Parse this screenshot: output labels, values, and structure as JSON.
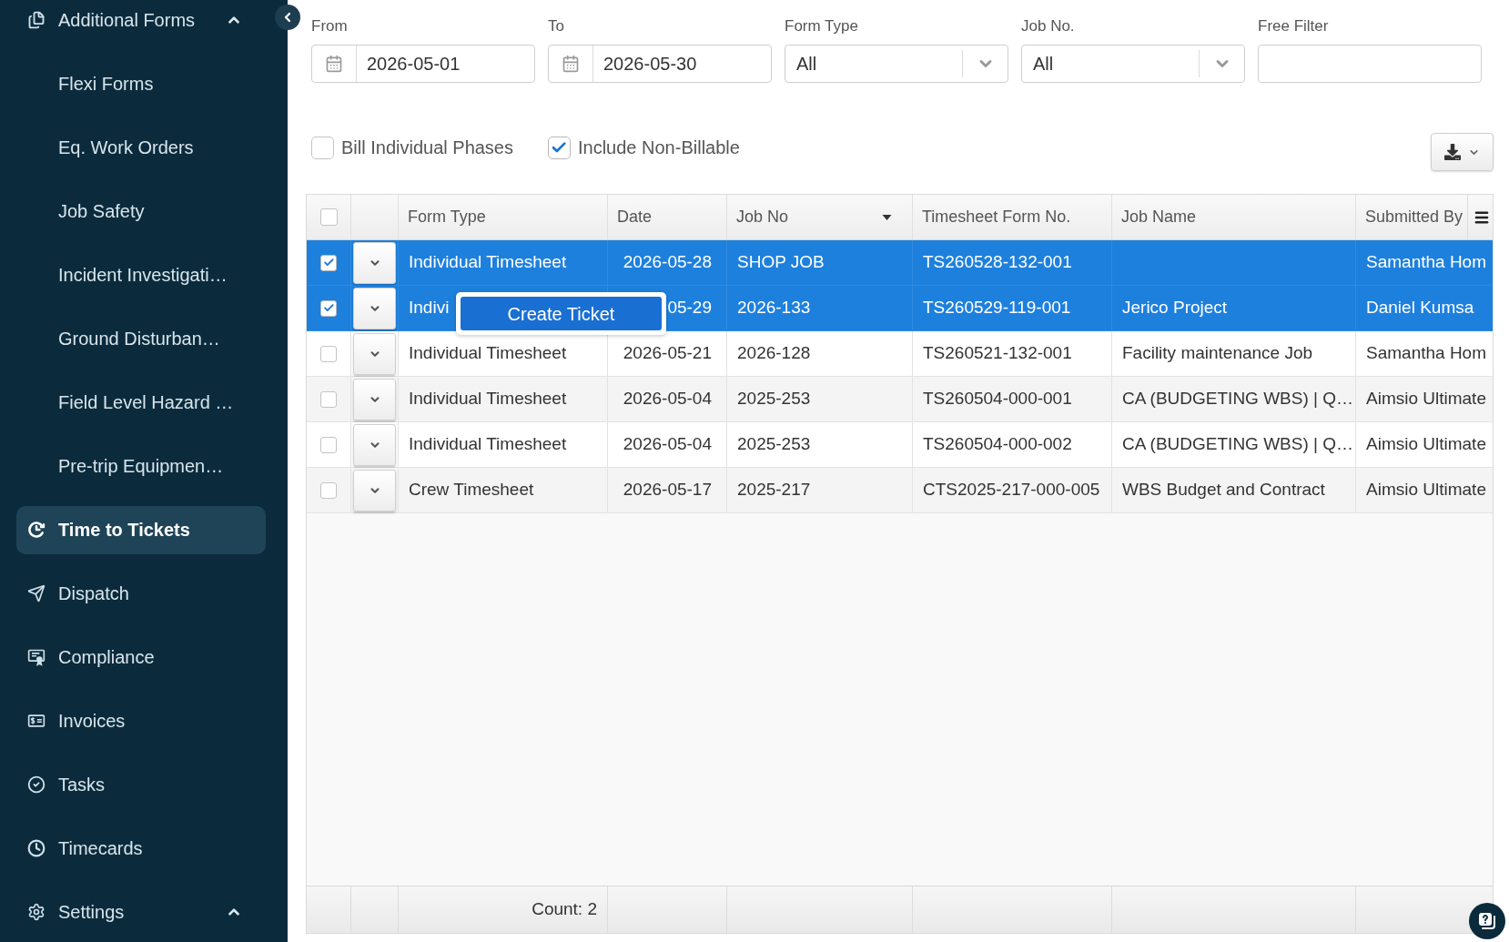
{
  "sidebar": {
    "items": [
      {
        "kind": "group",
        "label": "Additional Forms",
        "selected": false,
        "expanded": true,
        "children": [
          {
            "label": "Flexi Forms",
            "selected": false
          },
          {
            "label": "Eq. Work Orders",
            "selected": false
          },
          {
            "label": "Job Safety",
            "selected": false
          },
          {
            "label": "Incident Investigati…",
            "selected": false
          },
          {
            "label": "Ground Disturban…",
            "selected": false
          },
          {
            "label": "Field Level Hazard …",
            "selected": false
          },
          {
            "label": "Pre-trip Equipmen…",
            "selected": false
          }
        ]
      },
      {
        "kind": "link",
        "label": "Time to Tickets",
        "selected": true
      },
      {
        "kind": "link",
        "label": "Dispatch",
        "selected": false
      },
      {
        "kind": "link",
        "label": "Compliance",
        "selected": false
      },
      {
        "kind": "link",
        "label": "Invoices",
        "selected": false
      },
      {
        "kind": "link",
        "label": "Tasks",
        "selected": false
      },
      {
        "kind": "link",
        "label": "Timecards",
        "selected": false
      },
      {
        "kind": "group",
        "label": "Settings",
        "selected": false,
        "expanded": true
      }
    ]
  },
  "filters": [
    {
      "kind": "date",
      "label": "From",
      "value": "2026-05-01"
    },
    {
      "kind": "date",
      "label": "To",
      "value": "2026-05-30"
    },
    {
      "kind": "select",
      "label": "Form Type",
      "value": "All"
    },
    {
      "kind": "select",
      "label": "Job No.",
      "value": "All"
    },
    {
      "kind": "text",
      "label": "Free Filter"
    }
  ],
  "options": [
    {
      "label": "Bill Individual Phases",
      "checked": false
    },
    {
      "label": "Include Non-Billable",
      "checked": true
    }
  ],
  "table": {
    "select_all": {
      "checked": false
    },
    "columns": [
      {
        "label": "Form Type",
        "sorted": false
      },
      {
        "label": "Date",
        "sorted": false
      },
      {
        "label": "Job No",
        "sorted": true
      },
      {
        "label": "Timesheet Form No.",
        "sorted": false
      },
      {
        "label": "Job Name",
        "sorted": false
      },
      {
        "label": "Submitted By",
        "sorted": false
      }
    ],
    "rows": [
      {
        "selected": true,
        "form_type": "Individual Timesheet",
        "date": "2026-05-28",
        "job_no": "SHOP JOB",
        "form_no": "TS260528-132-001",
        "submitted_by": "Samantha Hom"
      },
      {
        "selected": true,
        "form_type": "Indivi",
        "date": "05-29",
        "job_no": "2026-133",
        "form_no": "TS260529-119-001",
        "job_name": "Jerico Project",
        "submitted_by": "Daniel Kumsa"
      },
      {
        "selected": false,
        "form_type": "Individual Timesheet",
        "date": "2026-05-21",
        "job_no": "2026-128",
        "form_no": "TS260521-132-001",
        "job_name": "Facility maintenance Job",
        "submitted_by": "Samantha Hom"
      },
      {
        "selected": false,
        "form_type": "Individual Timesheet",
        "date": "2026-05-04",
        "job_no": "2025-253",
        "form_no": "TS260504-000-001",
        "job_name": "CA (BUDGETING WBS) | Q…",
        "submitted_by": "Aimsio Ultimate"
      },
      {
        "selected": false,
        "form_type": "Individual Timesheet",
        "date": "2026-05-04",
        "job_no": "2025-253",
        "form_no": "TS260504-000-002",
        "job_name": "CA (BUDGETING WBS) | Q…",
        "submitted_by": "Aimsio Ultimate"
      },
      {
        "selected": false,
        "form_type": "Crew Timesheet",
        "date": "2026-05-17",
        "job_no": "2025-217",
        "form_no": "CTS2025-217-000-005",
        "job_name": "WBS Budget and Contract",
        "submitted_by": "Aimsio Ultimate"
      }
    ],
    "footer": {
      "count": "Count: 2"
    }
  },
  "context_menu": {
    "items": [
      {
        "label": "Create Ticket"
      }
    ]
  }
}
